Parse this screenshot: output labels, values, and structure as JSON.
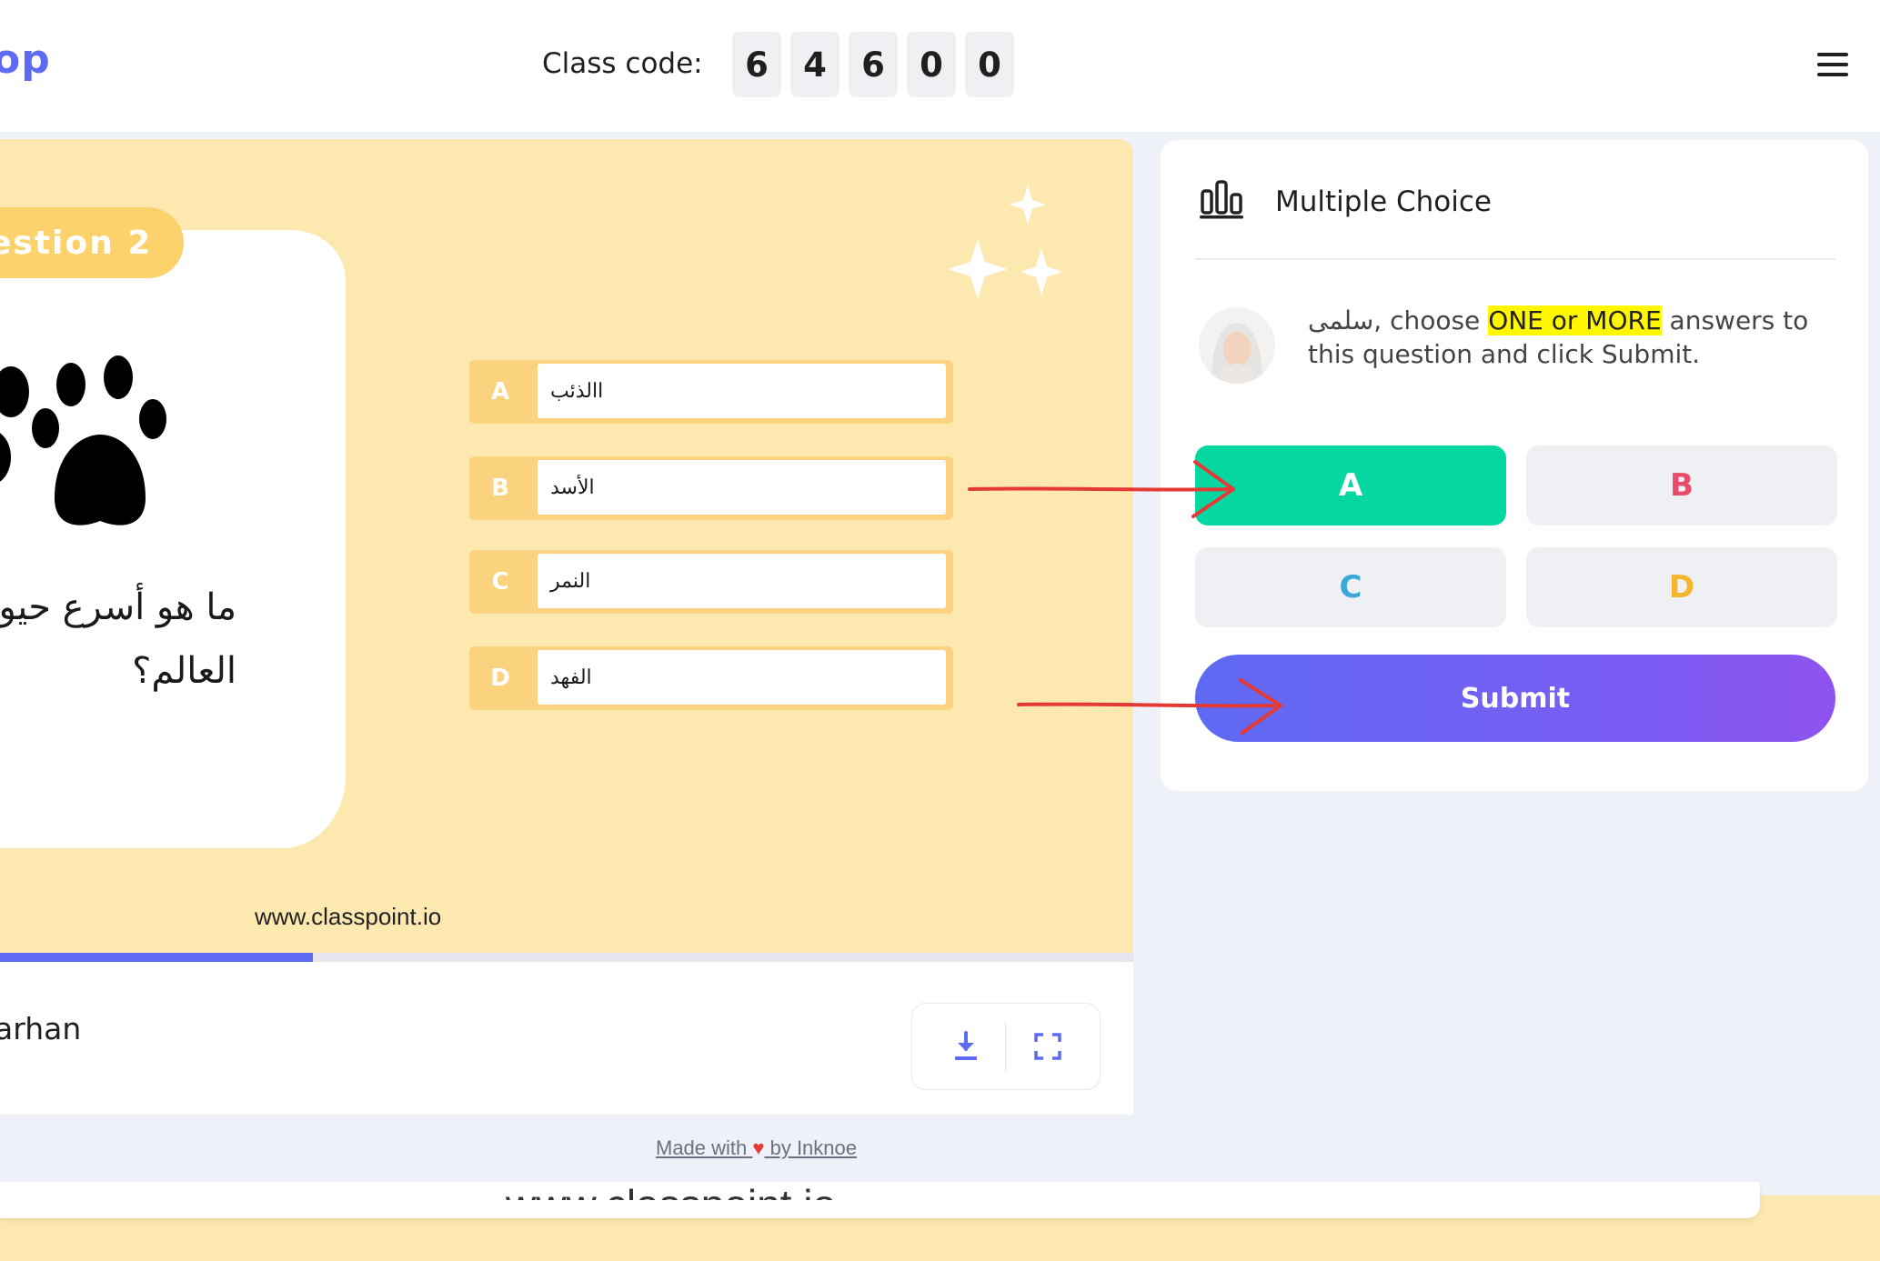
{
  "header": {
    "logo_fragment": "op",
    "class_code_label": "Class code:",
    "class_code_digits": [
      "6",
      "4",
      "6",
      "0",
      "0"
    ]
  },
  "slide": {
    "question_tag": "estion 2",
    "question_text_line1": "ما هو أسرع حيو",
    "question_text_line2": "العالم؟",
    "options": [
      {
        "letter": "A",
        "text": "االذئب"
      },
      {
        "letter": "B",
        "text": "الأسد"
      },
      {
        "letter": "C",
        "text": "النمر"
      },
      {
        "letter": "D",
        "text": "الفهد"
      }
    ],
    "watermark": "www.classpoint.io",
    "progress_fraction": 0.276
  },
  "slide_footer": {
    "presenter_name": "arhan",
    "download_icon": "download-icon",
    "fullscreen_icon": "fullscreen-icon"
  },
  "footer": {
    "made_with_prefix": "Made with",
    "made_with_suffix": "by Inknoe",
    "heart": "♥",
    "bottom_watermark": "www.classpoint.io"
  },
  "panel": {
    "title": "Multiple Choice",
    "icon": "bar-chart-icon",
    "student_name": "سلمى",
    "instruction_after_name": ", choose ",
    "instruction_highlight": "ONE or MORE",
    "instruction_rest": " answers to this question and click Submit.",
    "answers": [
      {
        "label": "A",
        "selected": true,
        "color": "#ffffff",
        "bg": "#06d6a0"
      },
      {
        "label": "B",
        "selected": false,
        "color": "#e94b6a",
        "bg": "#eef0f4"
      },
      {
        "label": "C",
        "selected": false,
        "color": "#3aa8d8",
        "bg": "#eef0f4"
      },
      {
        "label": "D",
        "selected": false,
        "color": "#f4b72a",
        "bg": "#eef0f4"
      }
    ],
    "submit_label": "Submit"
  },
  "colors": {
    "accent": "#5f6af2",
    "selected_green": "#06d6a0",
    "slide_bg": "#fde9b0",
    "annotation_red": "#e53935"
  }
}
